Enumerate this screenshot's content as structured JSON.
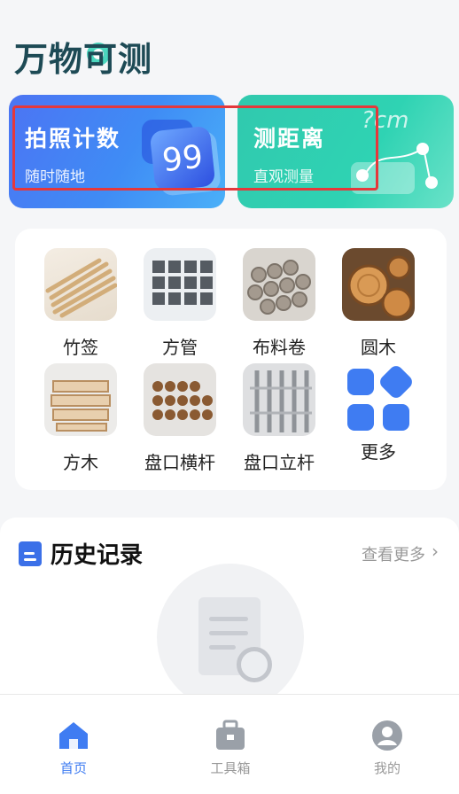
{
  "app": {
    "logo_text_1": "万物",
    "logo_text_2": "可",
    "logo_text_3": "测"
  },
  "cards": [
    {
      "title": "拍照计数",
      "subtitle": "随时随地",
      "badge": "99"
    },
    {
      "title": "测距离",
      "subtitle": "直观测量",
      "decor": "?cm"
    }
  ],
  "categories": [
    {
      "label": "竹签"
    },
    {
      "label": "方管"
    },
    {
      "label": "布料卷"
    },
    {
      "label": "圆木"
    },
    {
      "label": "方木"
    },
    {
      "label": "盘口横杆"
    },
    {
      "label": "盘口立杆"
    },
    {
      "label": "更多"
    }
  ],
  "history": {
    "title": "历史记录",
    "more": "查看更多",
    "chevron": "›"
  },
  "tabs": [
    {
      "label": "首页",
      "icon": "home-icon",
      "active": true
    },
    {
      "label": "工具箱",
      "icon": "toolbox-icon",
      "active": false
    },
    {
      "label": "我的",
      "icon": "user-icon",
      "active": false
    }
  ],
  "colors": {
    "accent": "#3f7cf2",
    "inactive": "#999999",
    "highlight": "#e5383b"
  }
}
